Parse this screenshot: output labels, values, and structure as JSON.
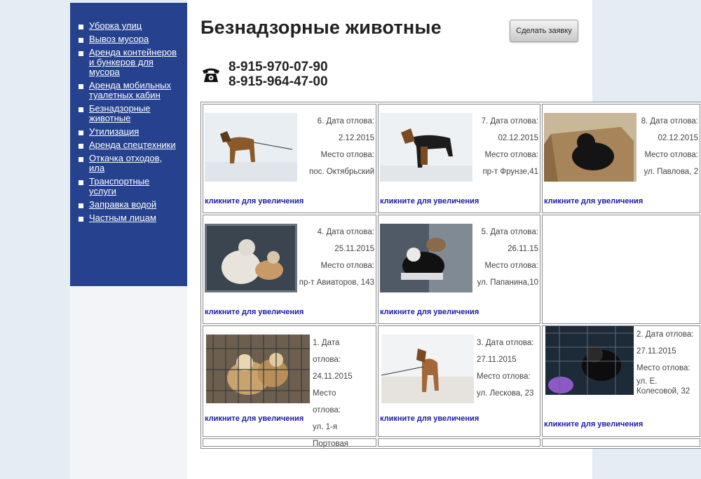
{
  "menu": [
    "Уборка улиц",
    "Вывоз мусора",
    "Аренда контейнеров и бункеров для мусора",
    "Аренда мобильных туалетных кабин",
    "Безнадзорные животные",
    "Утилизация",
    "Аренда спецтехники",
    "Откачка отходов, ила",
    "Транспортные услуги",
    "Заправка водой",
    "Частным лицам"
  ],
  "header": {
    "title": "Безнадзорные животные",
    "request_button": "Сделать заявку",
    "phone1": "8-915-970-07-90",
    "phone2": "8-915-964-47-00",
    "phone_icon": "telephone-icon"
  },
  "enlarge_label": "кликните для увеличения",
  "cards": [
    {
      "num_date": "6. Дата отлова:",
      "date": "2.12.2015",
      "place_label": "Место отлова:",
      "place": "пос. Октябрьский",
      "scene": "snow-brown"
    },
    {
      "num_date": "7. Дата отлова:",
      "date": "02.12.2015",
      "place_label": "Место отлова:",
      "place": "пр-т Фрунзе,41",
      "scene": "snow-black"
    },
    {
      "num_date": "8. Дата отлова:",
      "date": "02.12.2015",
      "place_label": "Место отлова:",
      "place": "ул. Павлова, 2",
      "scene": "box"
    },
    {
      "num_date": "4. Дата отлова:",
      "date": "25.11.2015",
      "place_label": "Место отлова:",
      "place": "пр-т Авиаторов, 143",
      "scene": "kennel-white"
    },
    {
      "num_date": "5. Дата отлова:",
      "date": "26.11.15",
      "place_label": "Место отлова:",
      "place": "ул. Папанина,10",
      "scene": "kennel-dark"
    },
    {
      "num_date": "1. Дата отлова:",
      "date": "24.11.2015",
      "place_label": "Место отлова:",
      "place": "ул. 1-я Портовая",
      "scene": "cage"
    },
    {
      "num_date": "3. Дата отлова:",
      "date": "27.11.2015",
      "place_label": "Место отлова:",
      "place": "ул. Лескова, 23",
      "scene": "snow-leash"
    },
    {
      "num_date": "2. Дата отлова:",
      "date": "27.11.2015",
      "place_label": "Место отлова:",
      "place": "ул. Е. Колесовой, 32",
      "scene": "cage-dark"
    }
  ]
}
